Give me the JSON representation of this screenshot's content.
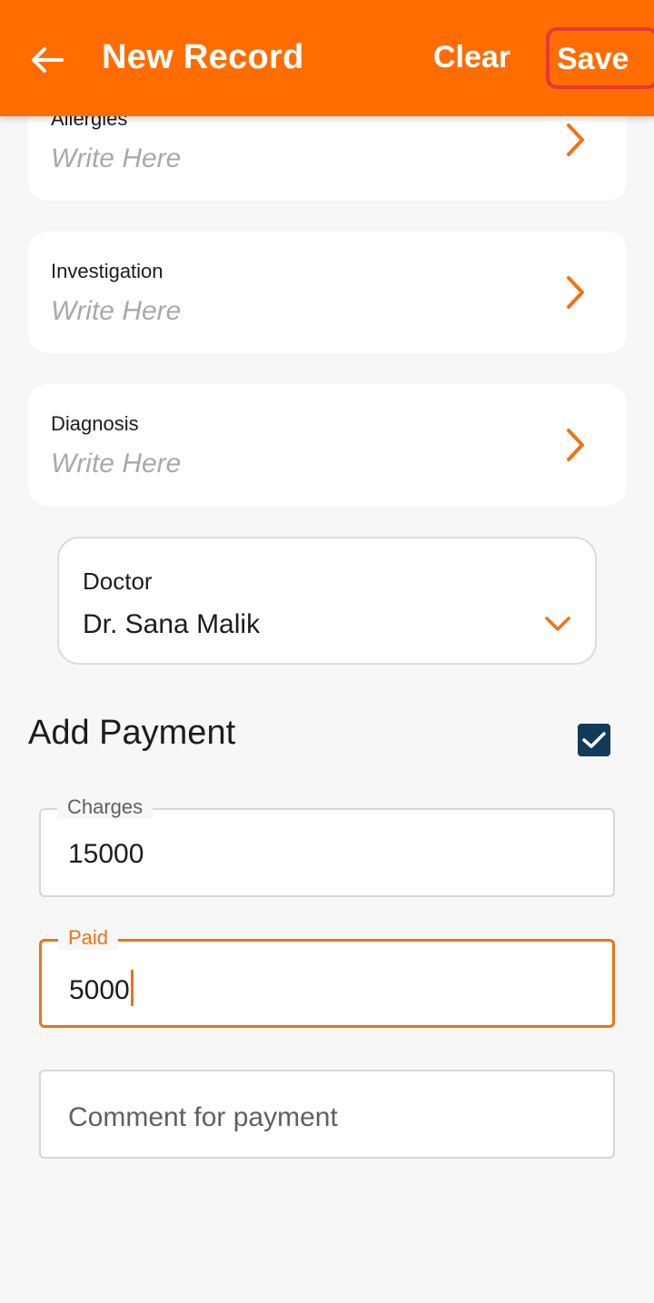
{
  "app_bar": {
    "title": "New Record",
    "clear_label": "Clear",
    "save_label": "Save",
    "color": "#ff6d00"
  },
  "cards": [
    {
      "label": "Allergies",
      "placeholder": "Write Here"
    },
    {
      "label": "Investigation",
      "placeholder": "Write Here"
    },
    {
      "label": "Diagnosis",
      "placeholder": "Write Here"
    }
  ],
  "doctor": {
    "label": "Doctor",
    "value": "Dr. Sana Malik"
  },
  "payment": {
    "title": "Add Payment",
    "enabled": true,
    "charges_label": "Charges",
    "charges_value": "15000",
    "paid_label": "Paid",
    "paid_value": "5000",
    "comment_placeholder": "Comment for payment"
  },
  "icons": {
    "back": "arrow-left-icon",
    "card_chevron": "chevron-right-icon",
    "dropdown": "chevron-down-icon",
    "check": "checkmark-icon"
  },
  "colors": {
    "accent": "#ff6d00",
    "focus": "#ef7217",
    "checkbox": "#13395b",
    "save_outline": "#e53935"
  }
}
